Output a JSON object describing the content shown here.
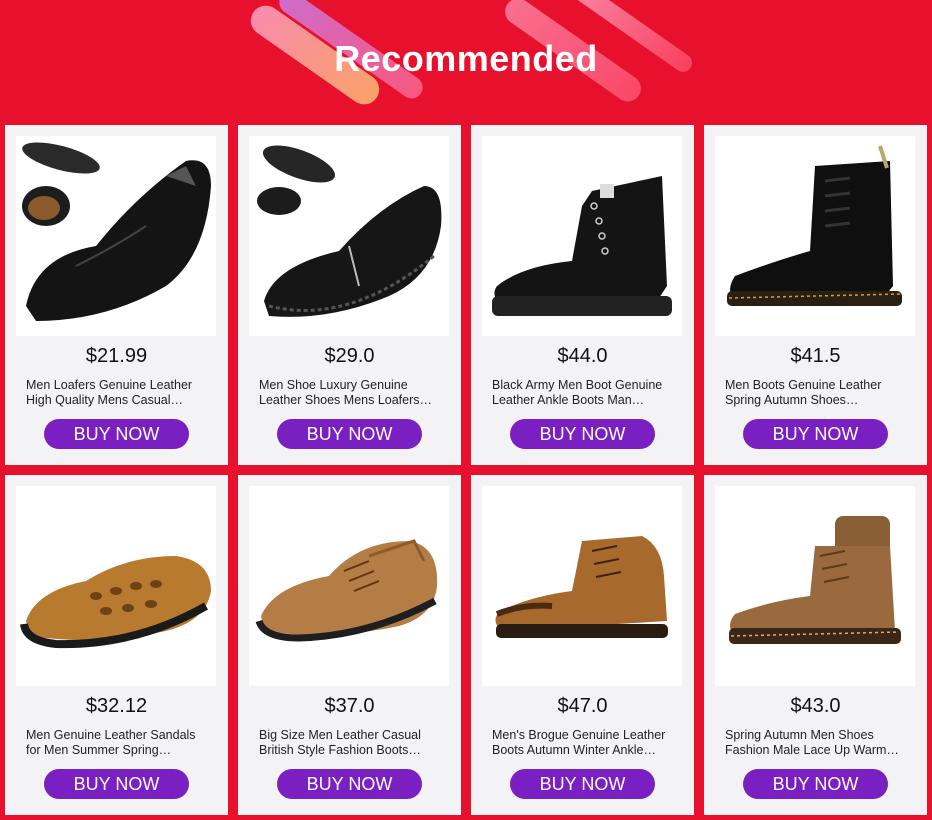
{
  "header": {
    "title": "Recommended"
  },
  "colors": {
    "background": "#e8112d",
    "card": "#f3f3f6",
    "button": "#7a1fc2"
  },
  "products": [
    {
      "price": "$21.99",
      "line1": "Men Loafers Genuine Leather",
      "line2": "High Quality Mens Casual…",
      "button": "BUY NOW",
      "image": "black-loafer-image"
    },
    {
      "price": "$29.0",
      "line1": "Men Shoe Luxury Genuine",
      "line2": "Leather Shoes Mens Loafers…",
      "button": "BUY NOW",
      "image": "black-zip-loafer-image"
    },
    {
      "price": "$44.0",
      "line1": "Black Army Men Boot Genuine",
      "line2": "Leather Ankle Boots Man…",
      "button": "BUY NOW",
      "image": "black-ankle-boot-image"
    },
    {
      "price": "$41.5",
      "line1": "Men Boots Genuine Leather",
      "line2": "Spring Autumn Shoes…",
      "button": "BUY NOW",
      "image": "black-lace-boot-image"
    },
    {
      "price": "$32.12",
      "line1": "Men Genuine Leather Sandals",
      "line2": "for Men Summer Spring…",
      "button": "BUY NOW",
      "image": "brown-sandal-image"
    },
    {
      "price": "$37.0",
      "line1": "Big Size Men Leather Casual",
      "line2": "British Style Fashion Boots…",
      "button": "BUY NOW",
      "image": "brown-casual-shoe-image"
    },
    {
      "price": "$47.0",
      "line1": "Men's Brogue Genuine Leather",
      "line2": "Boots Autumn Winter Ankle…",
      "button": "BUY NOW",
      "image": "brown-brogue-boot-image"
    },
    {
      "price": "$43.0",
      "line1": "Spring Autumn Men Shoes",
      "line2": "Fashion Male Lace Up Warm…",
      "button": "BUY NOW",
      "image": "suede-sock-boot-image"
    }
  ]
}
